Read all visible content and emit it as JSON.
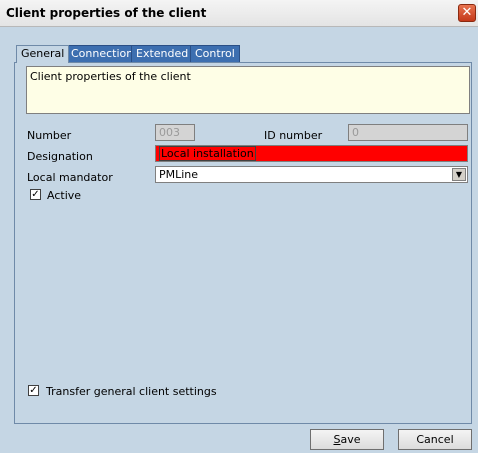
{
  "window": {
    "title": "Client properties of the client",
    "close_glyph": "✕"
  },
  "tabs": [
    {
      "label": "General",
      "active": true
    },
    {
      "label": "Connection",
      "active": false
    },
    {
      "label": "Extended",
      "active": false
    },
    {
      "label": "Control",
      "active": false
    }
  ],
  "general": {
    "description": "Client properties of the client",
    "number_label": "Number",
    "number_value": "003",
    "id_label": "ID number",
    "id_value": "0",
    "designation_label": "Designation",
    "designation_value": "Local installation",
    "mandator_label": "Local mandator",
    "mandator_value": "PMLine",
    "active_label": "Active",
    "active_checked": true,
    "transfer_label": "Transfer general client settings",
    "transfer_checked": true
  },
  "footer": {
    "save_rest": "ave",
    "save_mnemonic": "S",
    "cancel_label": "Cancel"
  },
  "colors": {
    "panel": "#c5d6e4",
    "tab_inactive": "#3d6fb0",
    "designation_bg": "#ff0000",
    "description_bg": "#fefee6"
  }
}
